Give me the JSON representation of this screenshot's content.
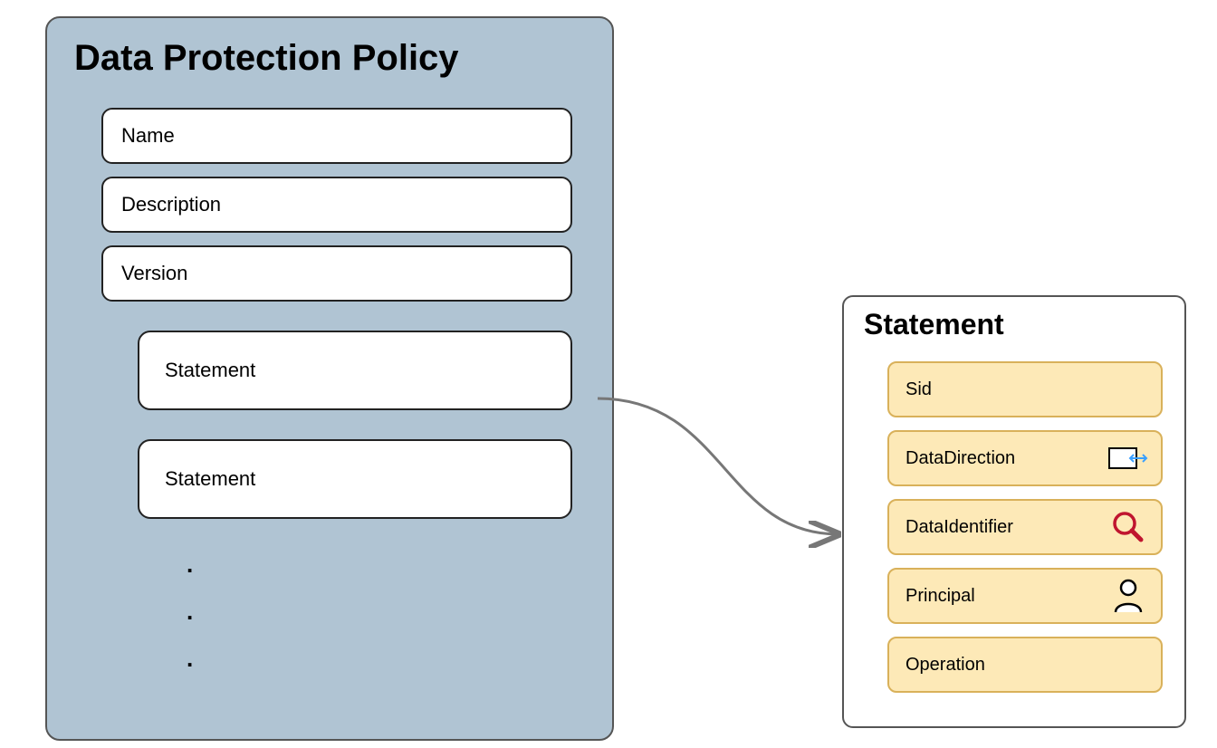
{
  "policy": {
    "title": "Data Protection Policy",
    "fields": {
      "name": "Name",
      "description": "Description",
      "version": "Version"
    },
    "statements": {
      "label1": "Statement",
      "label2": "Statement"
    },
    "ellipsis_dots": [
      ".",
      ".",
      "."
    ]
  },
  "statement_detail": {
    "title": "Statement",
    "fields": {
      "sid": "Sid",
      "data_direction": "DataDirection",
      "data_identifier": "DataIdentifier",
      "principal": "Principal",
      "operation": "Operation"
    }
  }
}
